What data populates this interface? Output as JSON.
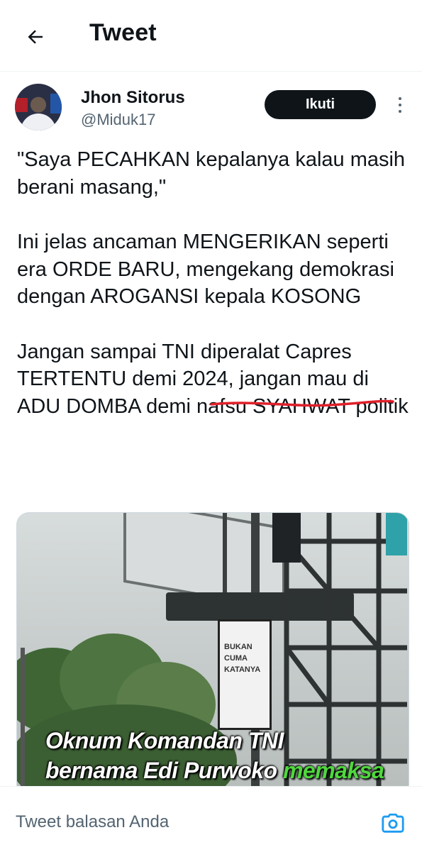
{
  "header": {
    "title": "Tweet",
    "back_icon": "arrow-left-icon"
  },
  "author": {
    "display_name": "Jhon Sitorus",
    "handle": "@Miduk17",
    "follow_label": "Ikuti",
    "more_icon": "more-vertical-icon"
  },
  "tweet": {
    "paragraphs": [
      "\"Saya PECAHKAN kepalanya kalau masih berani masang,\"",
      "Ini jelas ancaman MENGERIKAN seperti era ORDE BARU, mengekang demokrasi dengan AROGANSI kepala KOSONG",
      "Jangan sampai TNI diperalat Capres TERTENTU demi 2024, jangan mau di ADU DOMBA demi nafsu SYAHWAT politik"
    ],
    "underline_color": "#e0202a"
  },
  "media": {
    "caption_line1": "Oknum Komandan TNI",
    "caption_line2_a": "bernama Edi Purwoko ",
    "caption_line2_b": "memaksa",
    "caption_highlight_color": "#4fd83d",
    "poster_lines": [
      "BUKAN",
      "CUMA",
      "KATANYA"
    ]
  },
  "reply": {
    "placeholder": "Tweet balasan Anda",
    "camera_icon": "camera-icon",
    "accent": "#1d9bf0"
  }
}
